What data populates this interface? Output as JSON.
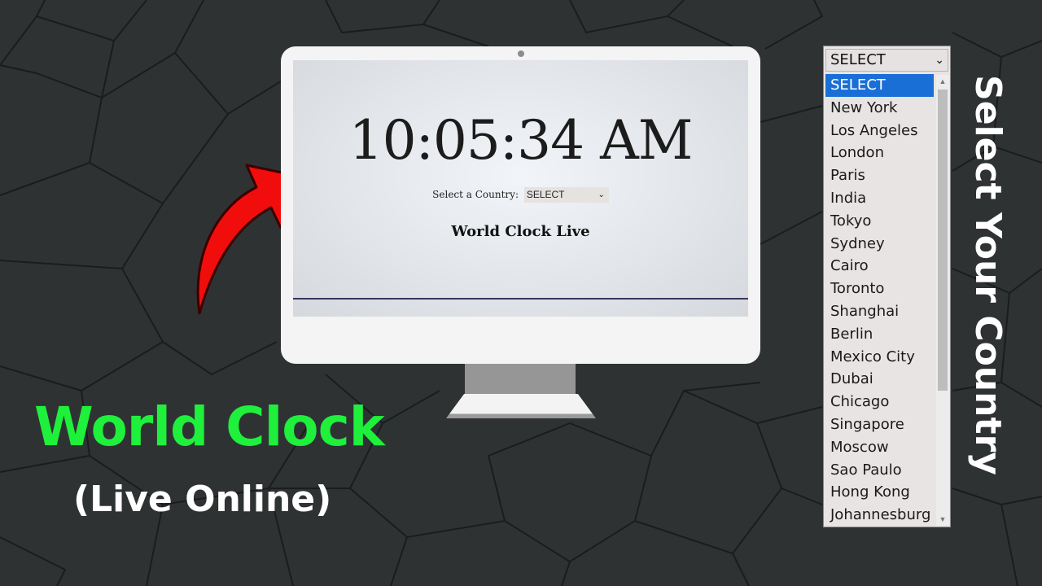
{
  "colors": {
    "background": "#2f3233",
    "headline": "#1ef03c",
    "arrow": "#f20d0d",
    "selected_option_bg": "#1a6fd6"
  },
  "monitor_screen": {
    "time": "10:05:34 AM",
    "select_label": "Select a Country:",
    "select_value": "SELECT",
    "subtitle": "World Clock Live"
  },
  "left_text": {
    "headline": "World Clock",
    "tagline": "(Live Online)"
  },
  "dropdown": {
    "current_value": "SELECT",
    "selected_index": 0,
    "options": [
      "SELECT",
      "New York",
      "Los Angeles",
      "London",
      "Paris",
      "India",
      "Tokyo",
      "Sydney",
      "Cairo",
      "Toronto",
      "Shanghai",
      "Berlin",
      "Mexico City",
      "Dubai",
      "Chicago",
      "Singapore",
      "Moscow",
      "Sao Paulo",
      "Hong Kong",
      "Johannesburg"
    ]
  },
  "vertical_caption": "Select Your Country",
  "icons": {
    "arrow": "curved-arrow-icon",
    "chevron": "chevron-down-icon"
  }
}
